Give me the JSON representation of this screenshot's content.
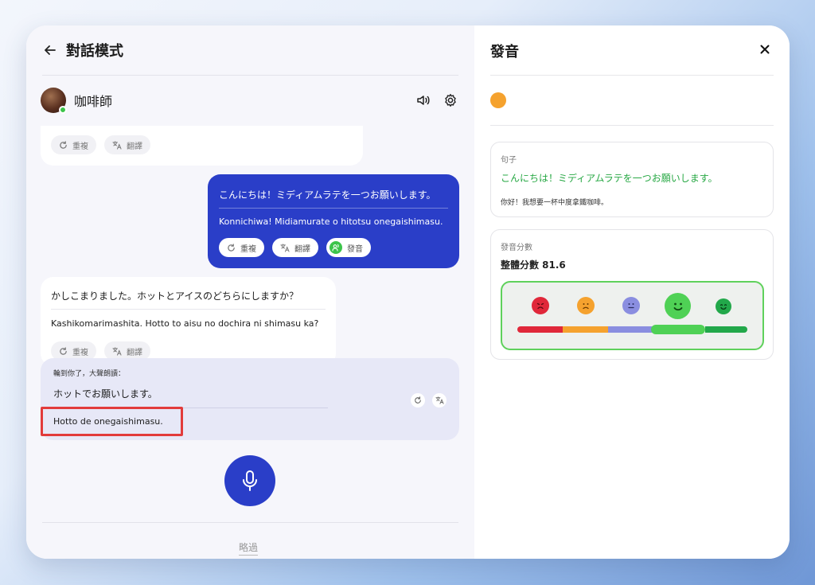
{
  "left": {
    "title": "對話模式",
    "character": {
      "name": "咖啡師"
    },
    "actions": {
      "repeat": "重複",
      "translate": "翻譯",
      "pronounce": "發音"
    },
    "messages": [
      {
        "jp": "こんにちは！ミディアムラテを一つお願いします。",
        "romaji": "Konnichiwa! Midiamurate o hitotsu onegaishimasu."
      },
      {
        "jp": "かしこまりました。ホットとアイスのどちらにしますか？",
        "romaji": "Kashikomarimashita. Hotto to aisu no dochira ni shimasu ka?"
      }
    ],
    "prompt": {
      "label": "輪到你了，大聲朗讀：",
      "jp": "ホットでお願いします。",
      "romaji": "Hotto de onegaishimasu."
    },
    "skip": "略過"
  },
  "right": {
    "title": "發音",
    "status_color": "#f5a22e",
    "sentence": {
      "label": "句子",
      "jp": "こんにちは！ミディアムラテを一つお願いします。",
      "zh": "你好！我想要一杯中度拿鐵咖啡。"
    },
    "score": {
      "label": "發音分數",
      "text": "整體分數 81.6",
      "value": 81.6,
      "level_index": 3
    },
    "meter_colors": [
      "#e0283a",
      "#f5a22e",
      "#8a8ee0",
      "#4fd155",
      "#22a84a"
    ]
  }
}
